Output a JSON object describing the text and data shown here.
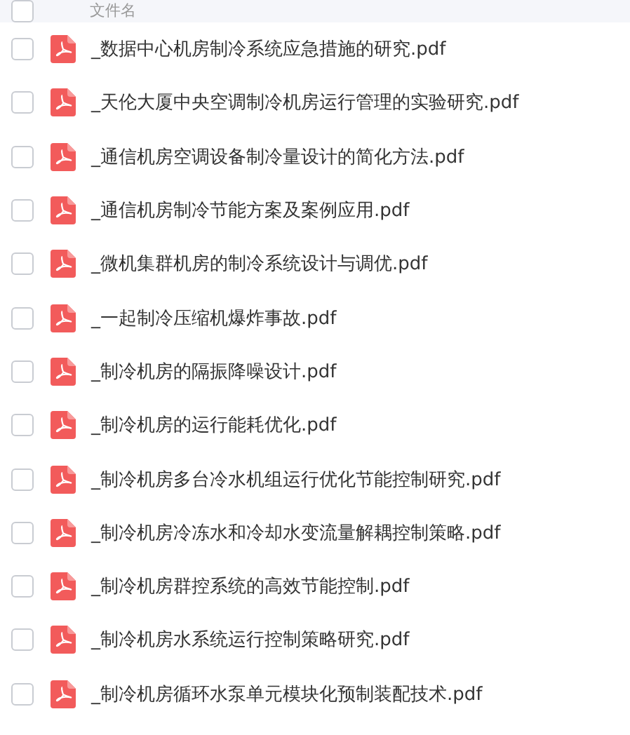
{
  "table": {
    "header": {
      "label": "文件名",
      "checked": false
    },
    "rows": [
      {
        "name": "_数据中心机房制冷系统应急措施的研究.pdf",
        "checked": false
      },
      {
        "name": "_天伦大厦中央空调制冷机房运行管理的实验研究.pdf",
        "checked": false
      },
      {
        "name": "_通信机房空调设备制冷量设计的简化方法.pdf",
        "checked": false
      },
      {
        "name": "_通信机房制冷节能方案及案例应用.pdf",
        "checked": false
      },
      {
        "name": "_微机集群机房的制冷系统设计与调优.pdf",
        "checked": false
      },
      {
        "name": "_一起制冷压缩机爆炸事故.pdf",
        "checked": false
      },
      {
        "name": "_制冷机房的隔振降噪设计.pdf",
        "checked": false
      },
      {
        "name": "_制冷机房的运行能耗优化.pdf",
        "checked": false
      },
      {
        "name": "_制冷机房多台冷水机组运行优化节能控制研究.pdf",
        "checked": false
      },
      {
        "name": "_制冷机房冷冻水和冷却水变流量解耦控制策略.pdf",
        "checked": false
      },
      {
        "name": "_制冷机房群控系统的高效节能控制.pdf",
        "checked": false
      },
      {
        "name": "_制冷机房水系统运行控制策略研究.pdf",
        "checked": false
      },
      {
        "name": "_制冷机房循环水泵单元模块化预制装配技术.pdf",
        "checked": false
      }
    ]
  }
}
